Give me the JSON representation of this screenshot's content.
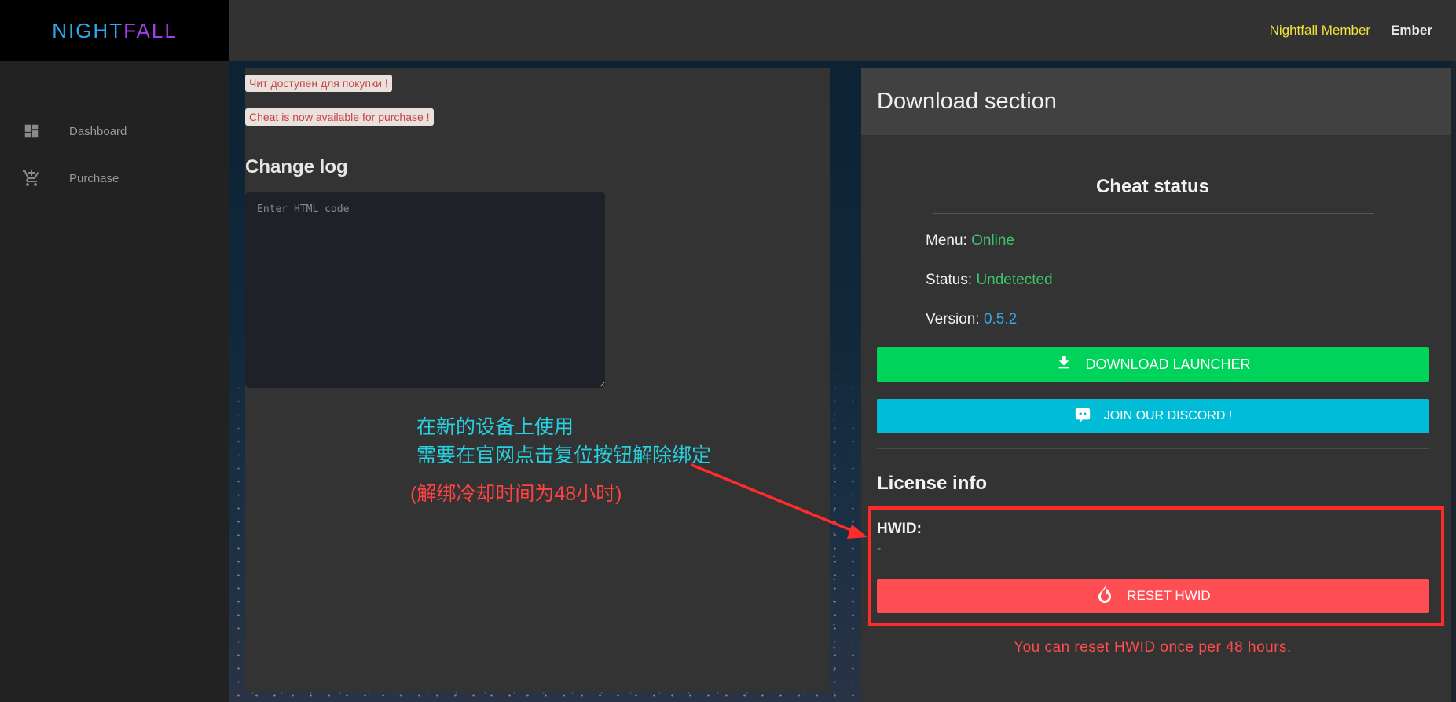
{
  "brand": {
    "part1": "NIGHT",
    "part2": "FALL"
  },
  "header": {
    "member_label": "Nightfall Member",
    "username": "Ember"
  },
  "sidebar": {
    "items": [
      {
        "label": "Dashboard",
        "icon": "dashboard-icon"
      },
      {
        "label": "Purchase",
        "icon": "cart-icon"
      }
    ]
  },
  "left": {
    "badge_ru": "Чит  доступен для покупки !",
    "badge_en": "Cheat is now available for purchase !",
    "changelog_title": "Change log",
    "changelog_placeholder": "Enter HTML code"
  },
  "annotations": {
    "line1": "在新的设备上使用",
    "line2": "需要在官网点击复位按钮解除绑定",
    "note": "(解绑冷却时间为48小时)"
  },
  "download": {
    "title": "Download section",
    "cheat_status_title": "Cheat status",
    "menu_label": "Menu:",
    "menu_value": "Online",
    "status_label": "Status:",
    "status_value": "Undetected",
    "version_label": "Version:",
    "version_value": "0.5.2",
    "download_button": "DOWNLOAD LAUNCHER",
    "discord_button": "JOIN OUR DISCORD !",
    "license_title": "License info",
    "hwid_label": "HWID:",
    "hwid_value": "-",
    "reset_button": "RESET HWID",
    "reset_note": "You can reset HWID once per 48 hours."
  },
  "colors": {
    "accent_green": "#00d35a",
    "accent_cyan": "#00bcd6",
    "accent_red": "#ff4d54",
    "status_green": "#3cc46a",
    "version_blue": "#3aa4e6",
    "member_yellow": "#f0e23a"
  }
}
